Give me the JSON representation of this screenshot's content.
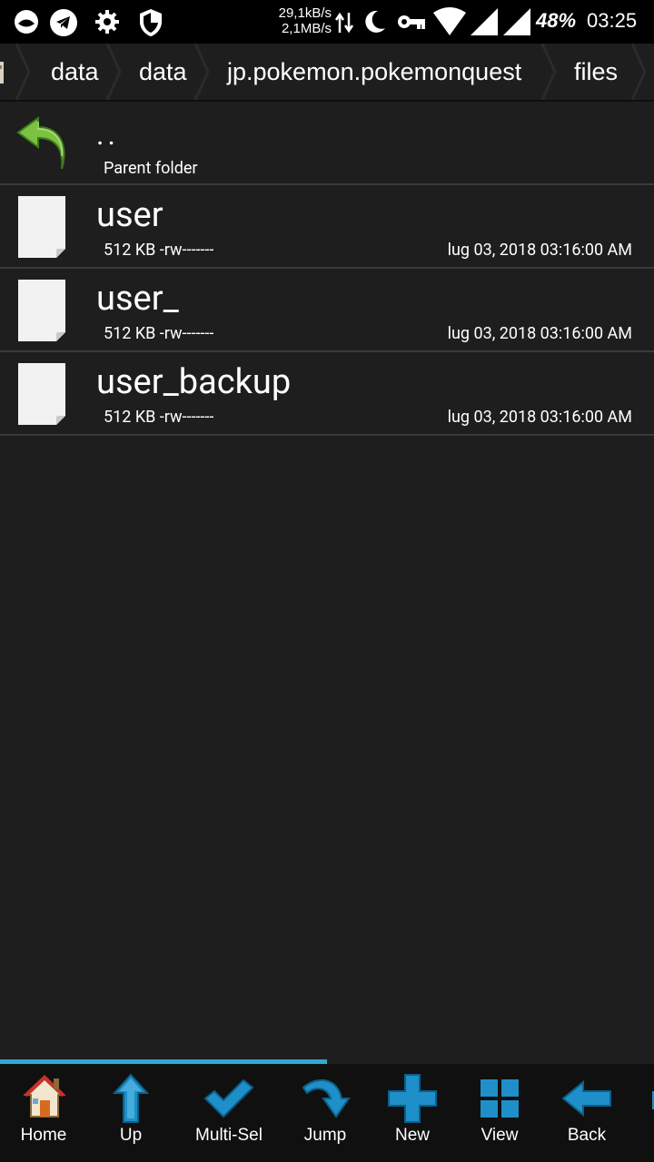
{
  "status_bar": {
    "upload_speed": "29,1kB/s",
    "download_speed": "2,1MB/s",
    "battery": "48%",
    "time": "03:25",
    "icons": [
      "messenger-icon",
      "telegram-icon",
      "settings-icon",
      "shield-icon",
      "data-transfer-icon",
      "moon-icon",
      "vpn-key-icon",
      "wifi-icon",
      "signal-icon",
      "signal-icon-2"
    ]
  },
  "breadcrumb": {
    "items": [
      "data",
      "data",
      "jp.pokemon.pokemonquest",
      "files"
    ]
  },
  "file_list": {
    "parent": {
      "name": "..",
      "label": "Parent folder"
    },
    "files": [
      {
        "name": "user",
        "size_perm": "512 KB -rw-------",
        "modified": "lug 03, 2018 03:16:00 AM"
      },
      {
        "name": "user_",
        "size_perm": "512 KB -rw-------",
        "modified": "lug 03, 2018 03:16:00 AM"
      },
      {
        "name": "user_backup",
        "size_perm": "512 KB -rw-------",
        "modified": "lug 03, 2018 03:16:00 AM"
      }
    ]
  },
  "progress": {
    "fraction": 0.5
  },
  "toolbar": {
    "home": "Home",
    "up": "Up",
    "multi_sel": "Multi-Sel",
    "jump": "Jump",
    "new": "New",
    "view": "View",
    "back": "Back"
  },
  "colors": {
    "background": "#1e1e1e",
    "accent": "#30a8d4",
    "toolbar_bg": "#101010",
    "parent_arrow": "#7cc242"
  }
}
